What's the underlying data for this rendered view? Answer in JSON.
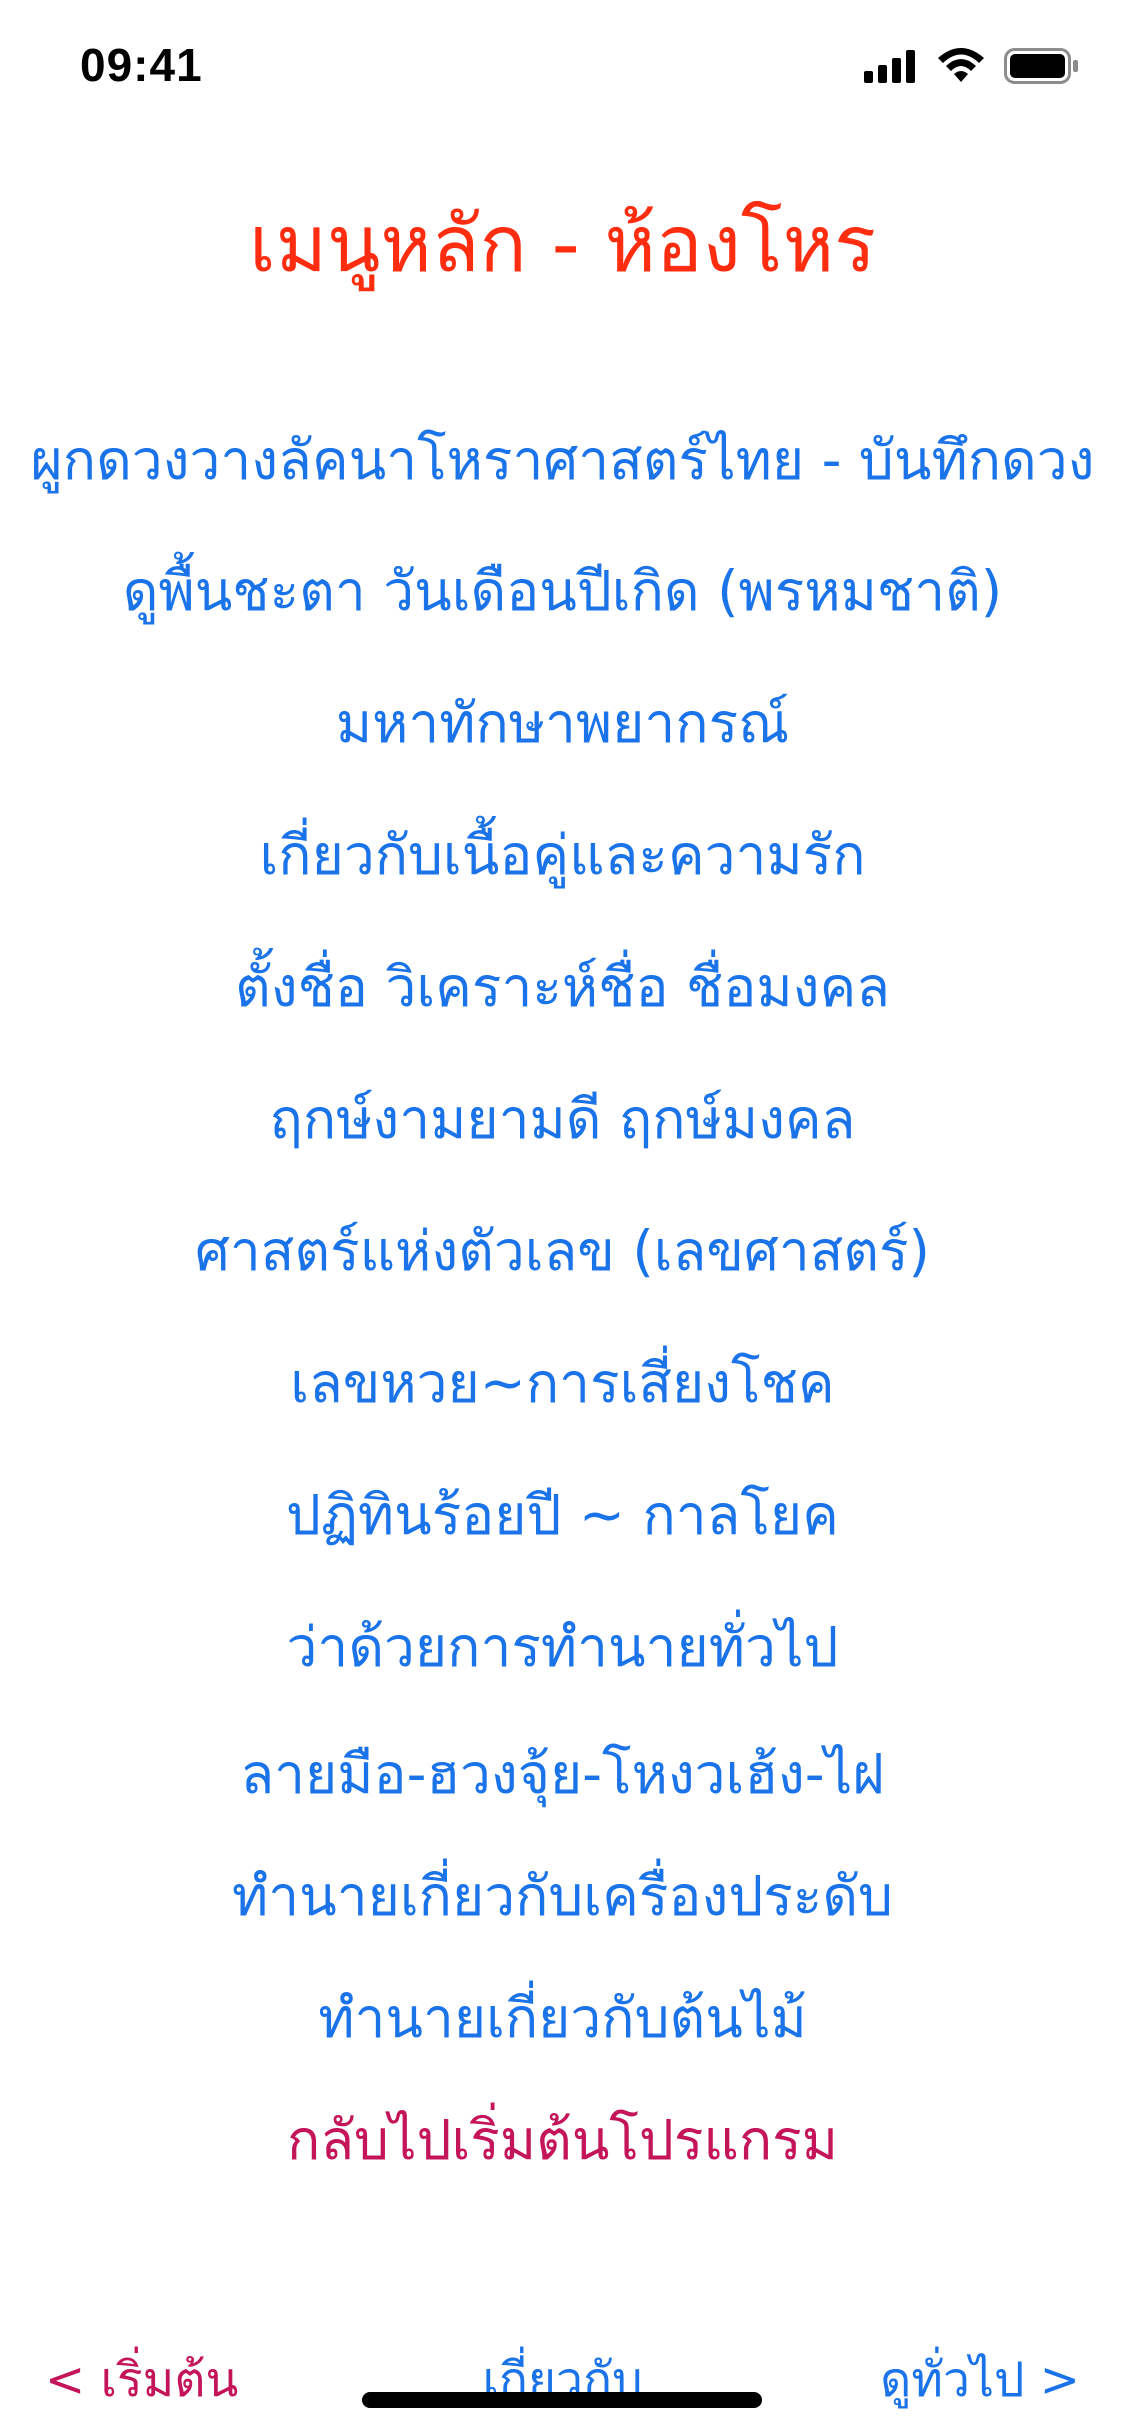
{
  "status_bar": {
    "time": "09:41"
  },
  "header": {
    "title": "เมนูหลัก - ห้องโหร"
  },
  "menu": {
    "items": [
      {
        "label": "ผูกดวงวางลัคนาโหราศาสตร์ไทย - บันทึกดวง"
      },
      {
        "label": "ดูพื้นชะตา วันเดือนปีเกิด (พรหมชาติ)"
      },
      {
        "label": "มหาทักษาพยากรณ์"
      },
      {
        "label": "เกี่ยวกับเนื้อคู่และความรัก"
      },
      {
        "label": "ตั้งชื่อ วิเคราะห์ชื่อ ชื่อมงคล"
      },
      {
        "label": "ฤกษ์งามยามดี ฤกษ์มงคล"
      },
      {
        "label": "ศาสตร์แห่งตัวเลข (เลขศาสตร์)"
      },
      {
        "label": "เลขหวย~การเสี่ยงโชค"
      },
      {
        "label": "ปฏิทินร้อยปี ~ กาลโยค"
      },
      {
        "label": "ว่าด้วยการทำนายทั่วไป"
      },
      {
        "label": "ลายมือ-ฮวงจุ้ย-โหงวเฮ้ง-ไฝ"
      },
      {
        "label": "ทำนายเกี่ยวกับเครื่องประดับ"
      },
      {
        "label": "ทำนายเกี่ยวกับต้นไม้"
      }
    ],
    "back_label": "กลับไปเริ่มต้นโปรแกรม"
  },
  "bottom_nav": {
    "start_label": "< เริ่มต้น",
    "about_label": "เกี่ยวกับ",
    "general_label": "ดูทั่วไป >"
  },
  "colors": {
    "title": "#ff2d10",
    "link": "#1a73e8",
    "accent": "#c4145a"
  }
}
